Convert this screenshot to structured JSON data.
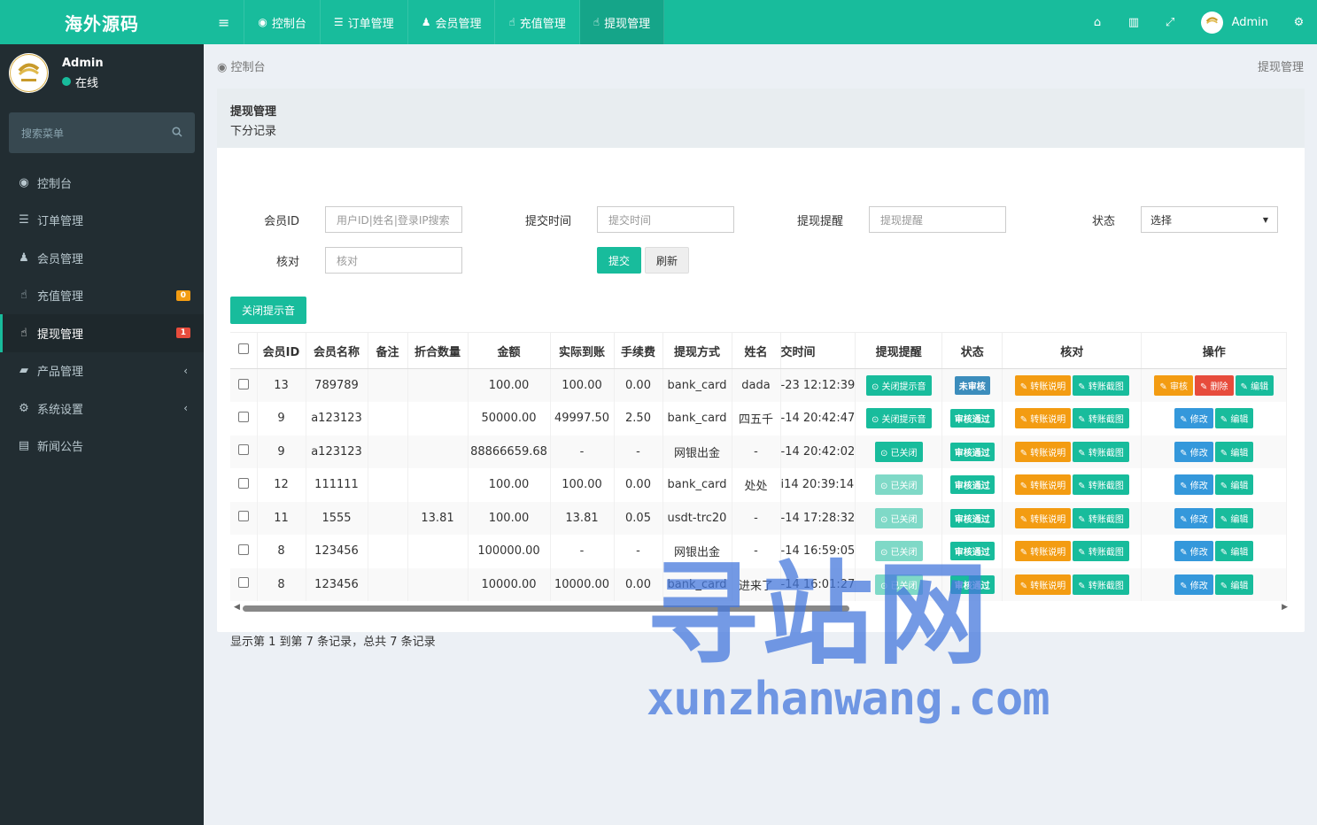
{
  "brand": "海外源码",
  "user": {
    "name": "Admin",
    "status": "在线"
  },
  "sidebar": {
    "search_placeholder": "搜索菜单",
    "items": [
      {
        "label": "控制台",
        "icon": "dashboard-icon"
      },
      {
        "label": "订单管理",
        "icon": "list-icon"
      },
      {
        "label": "会员管理",
        "icon": "users-icon"
      },
      {
        "label": "充值管理",
        "icon": "hand-icon"
      },
      {
        "label": "提现管理",
        "icon": "hand-icon",
        "active": true
      },
      {
        "label": "产品管理",
        "icon": "bag-icon"
      },
      {
        "label": "系统设置",
        "icon": "cogs-icon"
      },
      {
        "label": "新闻公告",
        "icon": "newspaper-icon"
      }
    ],
    "badges": {
      "recharge": "0",
      "withdraw": "1"
    }
  },
  "topnav": {
    "tabs": [
      "控制台",
      "订单管理",
      "会员管理",
      "充值管理",
      "提现管理"
    ],
    "admin": "Admin"
  },
  "breadcrumb": {
    "left": "控制台",
    "right": "提现管理"
  },
  "panel": {
    "title": "提现管理",
    "subtitle": "下分记录"
  },
  "filters": {
    "member_id": {
      "label": "会员ID",
      "placeholder": "用户ID|姓名|登录IP搜索"
    },
    "submit_time": {
      "label": "提交时间",
      "placeholder": "提交时间"
    },
    "remind": {
      "label": "提现提醒",
      "placeholder": "提现提醒"
    },
    "status": {
      "label": "状态",
      "value": "选择"
    },
    "check": {
      "label": "核对",
      "placeholder": "核对"
    },
    "submit_btn": "提交",
    "refresh_btn": "刷新"
  },
  "toggle_sound_btn": "关闭提示音",
  "table": {
    "headers": [
      "会员ID",
      "会员名称",
      "备注",
      "折合数量",
      "金额",
      "实际到账",
      "手续费",
      "提现方式",
      "姓名",
      "交时间",
      "提现提醒",
      "状态",
      "核对",
      "操作"
    ],
    "rows": [
      {
        "id": "13",
        "name": "789789",
        "note": "",
        "qty": "",
        "amount": "100.00",
        "actual": "100.00",
        "fee": "0.00",
        "method": "bank_card",
        "realname": "dada",
        "time": "-23 12:12:39",
        "remind": "关闭提示音",
        "remind_style": "success",
        "status": "未审核",
        "status_style": "primary",
        "ops": [
          "审核",
          "删除",
          "编辑"
        ]
      },
      {
        "id": "9",
        "name": "a123123",
        "note": "",
        "qty": "",
        "amount": "50000.00",
        "actual": "49997.50",
        "fee": "2.50",
        "method": "bank_card",
        "realname": "四五千",
        "time": "-14 20:42:47",
        "remind": "关闭提示音",
        "remind_style": "success",
        "status": "审核通过",
        "status_style": "success",
        "ops": [
          "修改",
          "编辑"
        ]
      },
      {
        "id": "9",
        "name": "a123123",
        "note": "",
        "qty": "",
        "amount": "88866659.68",
        "actual": "-",
        "fee": "-",
        "method": "网银出金",
        "realname": "-",
        "time": "-14 20:42:02",
        "remind": "已关闭",
        "remind_style": "success",
        "status": "审核通过",
        "status_style": "success",
        "ops": [
          "修改",
          "编辑"
        ]
      },
      {
        "id": "12",
        "name": "111111",
        "note": "",
        "qty": "",
        "amount": "100.00",
        "actual": "100.00",
        "fee": "0.00",
        "method": "bank_card",
        "realname": "处处",
        "time": "i14 20:39:14",
        "remind": "已关闭",
        "remind_style": "light",
        "status": "审核通过",
        "status_style": "success",
        "ops": [
          "修改",
          "编辑"
        ]
      },
      {
        "id": "11",
        "name": "1555",
        "note": "",
        "qty": "13.81",
        "amount": "100.00",
        "actual": "13.81",
        "fee": "0.05",
        "method": "usdt-trc20",
        "realname": "-",
        "time": "-14 17:28:32",
        "remind": "已关闭",
        "remind_style": "light",
        "status": "审核通过",
        "status_style": "success",
        "ops": [
          "修改",
          "编辑"
        ]
      },
      {
        "id": "8",
        "name": "123456",
        "note": "",
        "qty": "",
        "amount": "100000.00",
        "actual": "-",
        "fee": "-",
        "method": "网银出金",
        "realname": "-",
        "time": "-14 16:59:05",
        "remind": "已关闭",
        "remind_style": "light",
        "status": "审核通过",
        "status_style": "success",
        "ops": [
          "修改",
          "编辑"
        ]
      },
      {
        "id": "8",
        "name": "123456",
        "note": "",
        "qty": "",
        "amount": "10000.00",
        "actual": "10000.00",
        "fee": "0.00",
        "method": "bank_card",
        "realname": "进来了",
        "time": "-14 16:01:27",
        "remind": "已关闭",
        "remind_style": "light",
        "status": "审核通过",
        "status_style": "success",
        "ops": [
          "修改",
          "编辑"
        ]
      }
    ],
    "check_buttons": [
      "转账说明",
      "转账截图"
    ]
  },
  "footer": "显示第 1 到第 7 条记录，总共 7 条记录",
  "watermark": {
    "big": "寻站网",
    "small": "xunzhanwang.com"
  }
}
